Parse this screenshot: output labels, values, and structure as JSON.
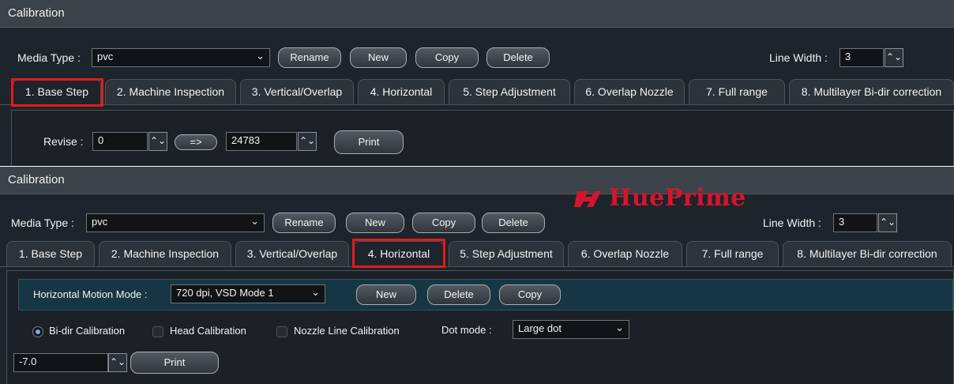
{
  "panel1": {
    "title": "Calibration",
    "media_type_label": "Media Type :",
    "media_type_value": "pvc",
    "buttons": {
      "rename": "Rename",
      "new": "New",
      "copy": "Copy",
      "delete": "Delete"
    },
    "line_width_label": "Line Width :",
    "line_width_value": "3",
    "tabs": [
      "1. Base Step",
      "2. Machine Inspection",
      "3. Vertical/Overlap",
      "4. Horizontal",
      "5. Step Adjustment",
      "6. Overlap Nozzle",
      "7. Full range",
      "8. Multilayer Bi-dir correction"
    ],
    "active_tab": "1. Base Step",
    "revise_label": "Revise :",
    "revise_value": "0",
    "arrow_button": "=>",
    "step_value": "24783",
    "print_label": "Print"
  },
  "panel2": {
    "title": "Calibration",
    "media_type_label": "Media Type :",
    "media_type_value": "pvc",
    "buttons": {
      "rename": "Rename",
      "new": "New",
      "copy": "Copy",
      "delete": "Delete"
    },
    "logo_text": "HuePrime",
    "line_width_label": "Line Width :",
    "line_width_value": "3",
    "tabs": [
      "1. Base Step",
      "2. Machine Inspection",
      "3. Vertical/Overlap",
      "4. Horizontal",
      "5. Step Adjustment",
      "6. Overlap Nozzle",
      "7. Full range",
      "8. Multilayer Bi-dir correction"
    ],
    "active_tab": "4. Horizontal",
    "motion_mode_label": "Horizontal Motion Mode :",
    "motion_mode_value": "720 dpi, VSD Mode 1",
    "mode_buttons": {
      "new": "New",
      "delete": "Delete",
      "copy": "Copy"
    },
    "options": {
      "bidir": "Bi-dir Calibration",
      "head": "Head Calibration",
      "nozzle": "Nozzle Line Calibration"
    },
    "selected_option": "Bi-dir Calibration",
    "dot_mode_label": "Dot mode :",
    "dot_mode_value": "Large dot",
    "offset_value": "-7.0",
    "print_label": "Print"
  },
  "colors": {
    "highlight": "#e01b1b",
    "brand": "#d5152d",
    "panel_bg": "#1e242b"
  }
}
